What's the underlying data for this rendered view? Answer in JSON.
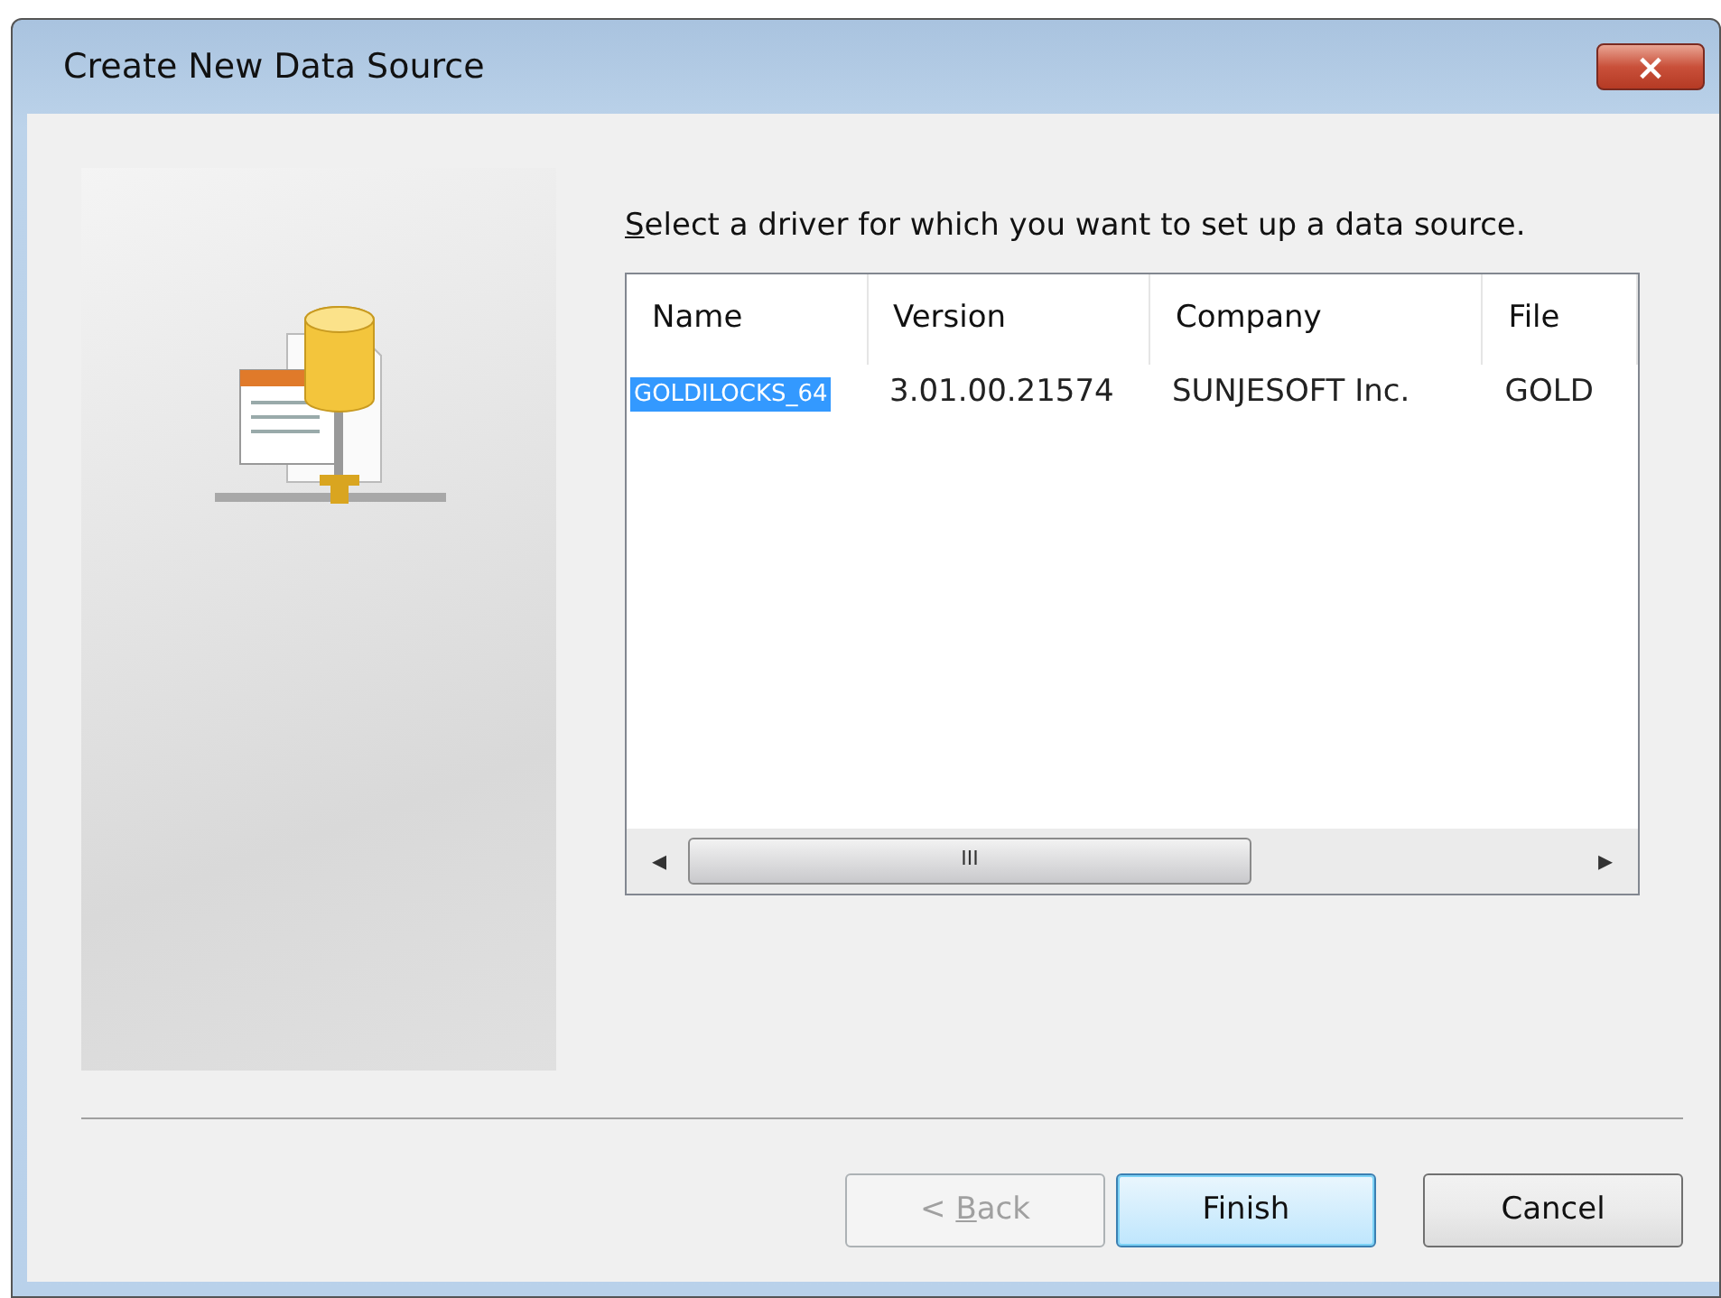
{
  "window": {
    "title": "Create New Data Source",
    "close": "×"
  },
  "instruction": {
    "key": "S",
    "rest": "elect a driver for which you want to set up a data source."
  },
  "table": {
    "columns": [
      "Name",
      "Version",
      "Company",
      "File"
    ],
    "rows": [
      {
        "selected": true,
        "cells": [
          "GOLDILOCKS_64",
          "3.01.00.21574",
          "SUNJESOFT Inc.",
          "GOLD"
        ]
      }
    ]
  },
  "scrollbar": {
    "left": "◂",
    "grip": "III",
    "right": "▸"
  },
  "buttons": [
    {
      "prefix": "< ",
      "key": "B",
      "rest": "ack",
      "disabled": true,
      "default": false
    },
    {
      "rest": "Finish",
      "disabled": false,
      "default": true
    },
    {
      "rest": "Cancel",
      "disabled": false,
      "default": false
    }
  ]
}
